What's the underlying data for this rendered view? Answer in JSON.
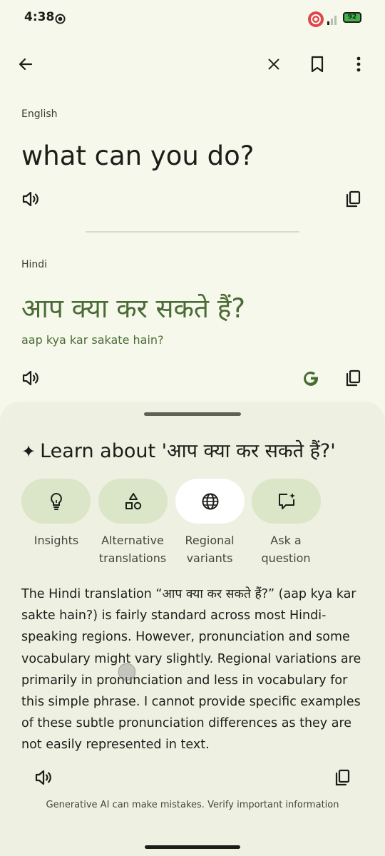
{
  "status_bar": {
    "time": "4:38",
    "battery": "92"
  },
  "source": {
    "language": "English",
    "text": "what can you do?"
  },
  "target": {
    "language": "Hindi",
    "text": "आप क्या कर सकते हैं?",
    "transliteration": "aap kya kar sakate hain?"
  },
  "learn": {
    "heading": "Learn about 'आप क्या कर सकते हैं?'",
    "sparkle": "✦",
    "chips": [
      {
        "label": "Insights",
        "icon": "lightbulb-icon"
      },
      {
        "label": "Alternative\ntranslations",
        "icon": "shapes-icon"
      },
      {
        "label": "Regional\nvariants",
        "icon": "globe-icon"
      },
      {
        "label": "Ask a\nquestion",
        "icon": "chat-sparkle-icon"
      }
    ],
    "selected": "Regional variants",
    "body": "The Hindi translation “आप क्या कर सकते हैं?” (aap kya kar sakte hain?) is fairly standard across most Hindi-speaking regions.  However, pronunciation and some vocabulary might vary slightly.  Regional variations are primarily in pronunciation and less in vocabulary for this simple phrase.  I cannot provide specific examples of these subtle pronunciation differences as they are not easily represented in text.",
    "disclaimer": "Generative AI can make mistakes. Verify important information"
  },
  "colors": {
    "background": "#f6f8eb",
    "sheet": "#eef0e2",
    "chip": "#dbe5c8",
    "chip_active": "#ffffff",
    "accent_green": "#4a6b36"
  }
}
